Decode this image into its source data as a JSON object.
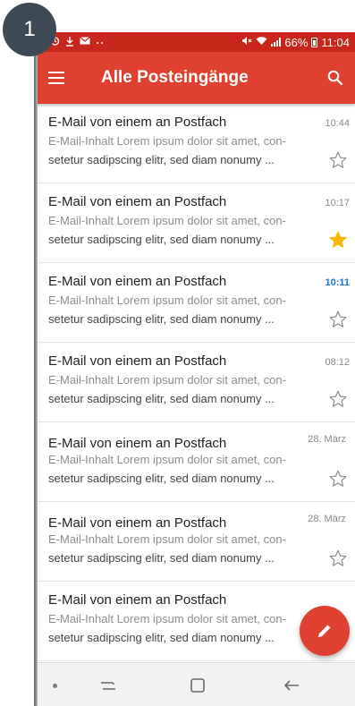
{
  "step": {
    "number": "1"
  },
  "statusbar": {
    "left_icons": [
      "alarm-icon",
      "download-icon",
      "mail-icon",
      "more-icon"
    ],
    "battery": "66%",
    "time": "11:04"
  },
  "appbar": {
    "title": "Alle Posteingänge",
    "color": "#e0402f"
  },
  "emails": [
    {
      "subject": "E-Mail von einem an Postfach",
      "time": "10:44",
      "line1": "E-Mail-Inhalt Lorem ipsum dolor sit amet, con-",
      "line2": "setetur sadipscing elitr, sed diam nonumy ...",
      "starred": false
    },
    {
      "subject": "E-Mail von einem an Postfach",
      "time": "10:17",
      "line1": "E-Mail-Inhalt Lorem ipsum dolor sit amet, con-",
      "line2": "setetur sadipscing elitr, sed diam nonumy ...",
      "starred": true
    },
    {
      "subject": "E-Mail von einem an Postfach",
      "time": "10:11",
      "line1": "E-Mail-Inhalt Lorem ipsum dolor sit amet, con-",
      "line2": "setetur sadipscing elitr, sed diam nonumy ...",
      "starred": false
    },
    {
      "subject": "E-Mail von einem an Postfach",
      "time": "08:12",
      "line1": "E-Mail-Inhalt Lorem ipsum dolor sit amet, con-",
      "line2": "setetur sadipscing elitr, sed diam nonumy ...",
      "starred": false
    },
    {
      "subject": "E-Mail von einem an Postfach",
      "time": "28. März",
      "line1": "E-Mail-Inhalt Lorem ipsum dolor sit amet, con-",
      "line2": "setetur sadipscing elitr, sed diam nonumy ...",
      "starred": false
    },
    {
      "subject": "E-Mail von einem an Postfach",
      "time": "28. März",
      "line1": "E-Mail-Inhalt Lorem ipsum dolor sit amet, con-",
      "line2": "setetur sadipscing elitr, sed diam nonumy ...",
      "starred": false
    },
    {
      "subject": "E-Mail von einem an Postfach",
      "time": "",
      "line1": "E-Mail-Inhalt Lorem ipsum dolor sit amet, con-",
      "line2": "setetur sadipscing elitr, sed diam nonumy ...",
      "starred": false
    }
  ],
  "colors": {
    "star_filled": "#f9b800",
    "star_empty": "#8a8a8a",
    "time_highlight": "#1a73e8"
  },
  "fab": {
    "icon": "pencil-icon"
  },
  "navbar": {
    "icons": [
      "recent-apps-icon",
      "home-icon",
      "back-icon"
    ]
  }
}
